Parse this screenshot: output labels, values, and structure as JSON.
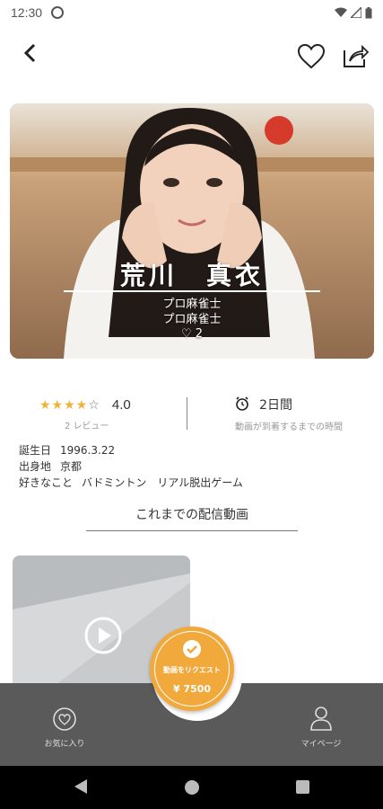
{
  "status_bar": {
    "time": "12:30"
  },
  "profile_header": {
    "name": "荒川　真衣",
    "title_1": "プロ麻雀士",
    "title_2": "プロ麻雀士",
    "like_count": "2"
  },
  "rating": {
    "stars": "★★★★",
    "empty_star": "☆",
    "value": "4.0",
    "reviews_label": "2 レビュー"
  },
  "delivery": {
    "value": "2日間",
    "label": "動画が到着するまでの時間"
  },
  "profile_info": {
    "birthday_label": "誕生日",
    "birthday_value": "1996.3.22",
    "hometown_label": "出身地",
    "hometown_value": "京都",
    "likes_label": "好きなこと",
    "likes_value": "バドミントン　リアル脱出ゲーム"
  },
  "videos_section": {
    "title": "これまでの配信動画"
  },
  "request_button": {
    "label": "動画をリクエスト",
    "price": "¥ 7500",
    "color": "#f2a93b"
  },
  "bottom_nav": {
    "favorites_label": "お気に入り",
    "mypage_label": "マイページ"
  }
}
